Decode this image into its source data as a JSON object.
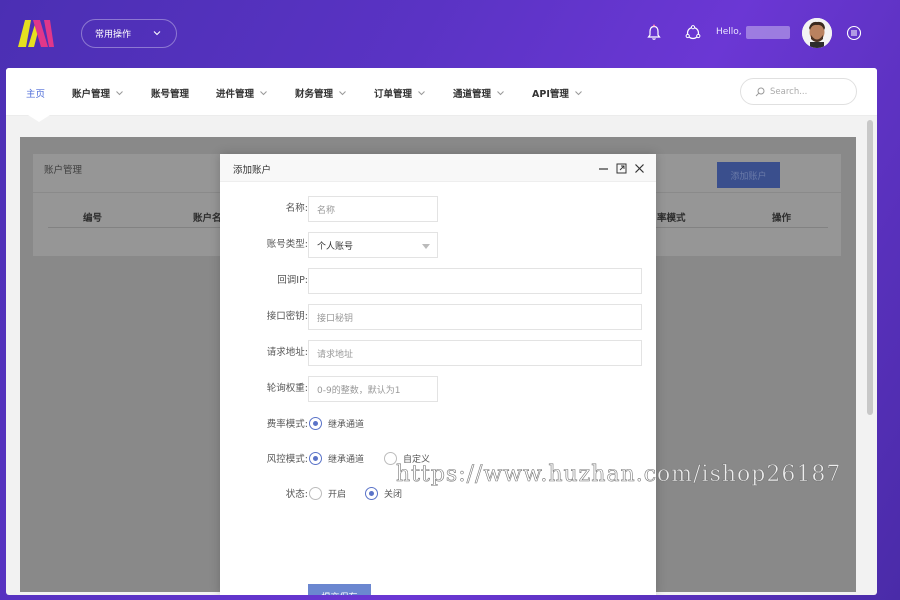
{
  "topbar": {
    "quick_label": "常用操作",
    "hello": "Hello,"
  },
  "nav": {
    "items": [
      {
        "label": "主页",
        "active": true,
        "dropdown": false
      },
      {
        "label": "账户管理",
        "dropdown": true
      },
      {
        "label": "账号管理",
        "dropdown": false
      },
      {
        "label": "进件管理",
        "dropdown": true
      },
      {
        "label": "财务管理",
        "dropdown": true
      },
      {
        "label": "订单管理",
        "dropdown": true
      },
      {
        "label": "通道管理",
        "dropdown": true
      },
      {
        "label": "API管理",
        "dropdown": true
      }
    ],
    "search_placeholder": "Search..."
  },
  "panel": {
    "title": "账户管理",
    "add_button": "添加账户",
    "columns": [
      "编号",
      "账户名",
      "率模式",
      "操作"
    ]
  },
  "modal": {
    "title": "添加账户",
    "fields": {
      "name": {
        "label": "名称:",
        "placeholder": "名称"
      },
      "account_type": {
        "label": "账号类型:",
        "value": "个人账号"
      },
      "callback_ip": {
        "label": "回调IP:",
        "placeholder": ""
      },
      "api_secret": {
        "label": "接口密钥:",
        "placeholder": "接口秘钥"
      },
      "request_url": {
        "label": "请求地址:",
        "placeholder": "请求地址"
      },
      "weight": {
        "label": "轮询权重:",
        "placeholder": "0-9的整数，默认为1"
      },
      "rate_mode": {
        "label": "费率模式:",
        "options": [
          "继承通道"
        ]
      },
      "risk_mode": {
        "label": "风控模式:",
        "options": [
          "继承通道",
          "自定义"
        ]
      },
      "status": {
        "label": "状态:",
        "options": [
          "开启",
          "关闭"
        ]
      }
    },
    "submit": "提交保存"
  },
  "watermark": "https://www.huzhan.com/ishop26187",
  "colors": {
    "accent": "#4c6bd8",
    "submit": "#6b87d0",
    "radio": "#5a73c8",
    "logo_yellow": "#e6e020",
    "logo_pink": "#e0378a"
  }
}
